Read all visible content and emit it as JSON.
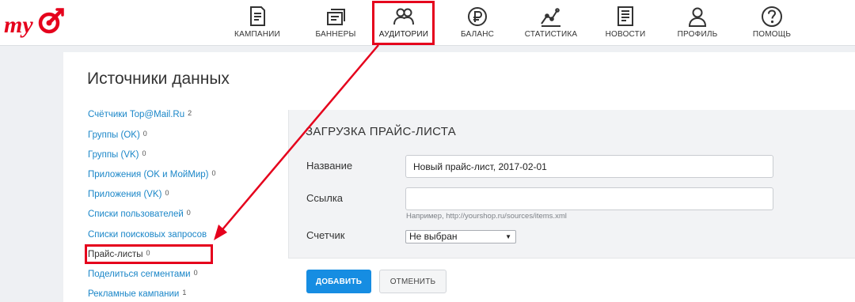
{
  "brand": {
    "accent": "#e5001c",
    "link": "#1a86c8",
    "primary_button": "#168de2"
  },
  "nav": {
    "items": [
      {
        "key": "campaigns",
        "label": "КАМПАНИИ",
        "icon": "campaigns-icon"
      },
      {
        "key": "banners",
        "label": "БАННЕРЫ",
        "icon": "banners-icon"
      },
      {
        "key": "audiences",
        "label": "АУДИТОРИИ",
        "icon": "audiences-icon",
        "active": true
      },
      {
        "key": "balance",
        "label": "БАЛАНС",
        "icon": "ruble-icon"
      },
      {
        "key": "statistics",
        "label": "СТАТИСТИКА",
        "icon": "statistics-icon"
      },
      {
        "key": "news",
        "label": "НОВОСТИ",
        "icon": "news-icon"
      },
      {
        "key": "profile",
        "label": "ПРОФИЛЬ",
        "icon": "profile-icon"
      },
      {
        "key": "help",
        "label": "ПОМОЩЬ",
        "icon": "help-icon"
      }
    ]
  },
  "page": {
    "title": "Источники данных"
  },
  "sources": [
    {
      "label": "Счётчики Top@Mail.Ru",
      "count": "2"
    },
    {
      "label": "Группы (OK)",
      "count": "0"
    },
    {
      "label": "Группы (VK)",
      "count": "0"
    },
    {
      "label": "Приложения (OK и МойМир)",
      "count": "0"
    },
    {
      "label": "Приложения (VK)",
      "count": "0"
    },
    {
      "label": "Списки пользователей",
      "count": "0"
    },
    {
      "label": "Списки поисковых запросов",
      "count": ""
    },
    {
      "label": "Прайс-листы",
      "count": "0",
      "current": true
    },
    {
      "label": "Поделиться сегментами",
      "count": "0"
    },
    {
      "label": "Рекламные кампании",
      "count": "1"
    }
  ],
  "form": {
    "title": "ЗАГРУЗКА ПРАЙС-ЛИСТА",
    "name_label": "Название",
    "name_value": "Новый прайс-лист, 2017-02-01",
    "link_label": "Ссылка",
    "link_value": "",
    "link_hint": "Например, http://yourshop.ru/sources/items.xml",
    "counter_label": "Счетчик",
    "counter_value": "Не выбран",
    "add_label": "ДОБАВИТЬ",
    "cancel_label": "ОТМЕНИТЬ"
  }
}
